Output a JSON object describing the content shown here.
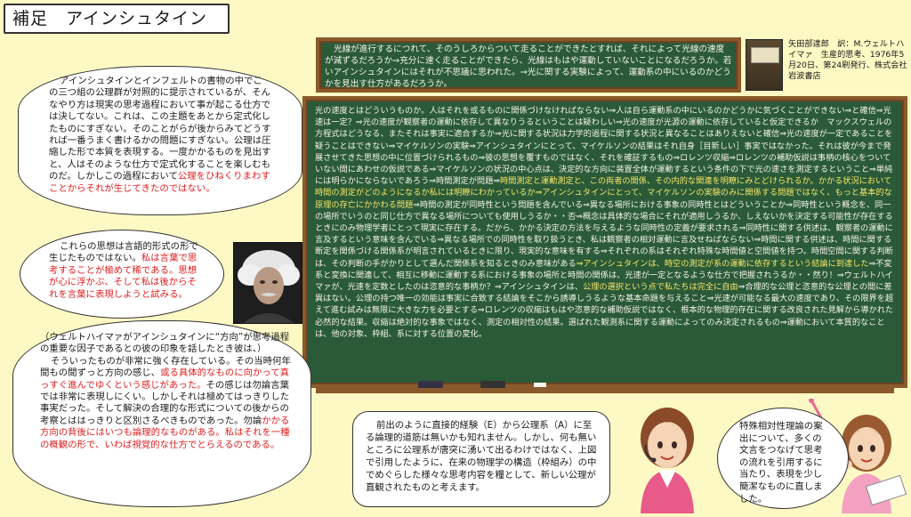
{
  "title": "補足　アインシュタイン",
  "book": {
    "info": "矢田部達郎　訳：M.ウェルトハイマァ　生産的思考、1976年5月20日、第24刷発行、株式会社　岩波書店"
  },
  "top_board": {
    "text": "光線が進行するにつれて、そのうしろからついて走ることができたとすれば、それによって光線の速度が減ずるだろうか⇒充分に速く走ることができたら、光線はもはや運動していないことになるだろうか。若いアインシュタインにはそれが不思議に思われた。⇒光に関する実験によって、運動系の中にいるのかどうかを見出す仕方があるだろうか。"
  },
  "main_board": {
    "t1": "光の速度とはどういうものか。人はそれを或るものに関係づけなければならない⇒人は自ら運動系の中にいるのかどうかに気づくことができない⇒と確信⇒光速は一定？⇒光の速度が観察者の運動に依存して異なりうるということは疑わしい⇒光の速度が光源の運動に依存していると仮定できるか　マックスウェルの方程式はどうなる、またそれは事実に適合するか⇒光に関する状況は力学的過程に関する状況と異なることはありえないと確信⇒光の速度が一定であることを疑うことはできない⇒マイケルソンの実験⇒アインシュタインにとって、マイケルソンの結果はそれ自身［目新しい］事実ではなかった。それは彼が今まで発展させてきた思想の中に位置づけられるもの⇒彼の思想を覆すものではなく、それを確証するもの⇒ロレンツ収縮⇒ロレンツの補助仮説は事柄の核心をついていない間にあわせの仮説である⇒マイケルソンの状況の中心点は、決定的な方向に装置全体が運動するという条件の下で光の速さを測定するということ⇒単純には明らかにならないであろう⇒時間測定が問題⇒",
    "t2": "時間測定と運動測定と、この両者の関係、その内的な関連を明瞭にみとどけられるか。かかる状況において時間の測定がどのようになるか私には明瞭にわかっているか⇒アインシュタインにとって、マイケルソンの実験のみに関係する問題ではなく、もっと基本的な原理の存亡にかかわる問題",
    "t3": "⇒時間の測定が同時性という問題を含んでいる⇒異なる場所における事象の同時性とはどういうことか⇒同時性という概念を、同一の場所でいうのと同じ仕方で異なる場所についても使用しうるか・・否⇒概念は具体的な場合にそれが適用しうるか、しえないかを決定する可能性が存在するときにのみ物理学者にとって現実に存在する。だから、かかる決定の方法を与えるような同時性の定義が要求される⇒同時性に関する供述は、観察者の運動に言及するという意味を含んでいる⇒異なる場所での同時性を取り扱うとき、私は観察者の相対運動に言及せねばならない⇒時間に関する供述は、時間に関する断定を関係づける関係系が明言されているときに限り、現実的な意味を有する⇒それぞれの系はそれぞれ特殊な時間値と空間値を持つ。時間空間に関する判断は、その判断の手がかりとして選んだ関係系を知るときのみ意味がある",
    "t4": "⇒アインシュタインは、時空の測定が系の運動に依存するという結論に到達した",
    "t5": "⇒不変系と変換に関連して、相互に移動に運動する系における事象の場所と時間の関係は、光速が一定となるような仕方で把握されうるか・・然り！⇒ウェルトハイマァが、光速を定数としたのは恣意的な事柄か？⇒アインシュタインは、",
    "t6": "公理の選択という点で私たちは完全に自由",
    "t7": "⇒合理的な公理と恣意的な公理との間に差異はない。公理の持つ唯一の効能は事実に合致する結論をそこから誘導しうるような基本命題を与えること⇒光速が可能なる最大の速度であり、その限界を超えて進む試みは無限に大きな力を必要とする⇒ロレンツの収縮はもはや恣意的な補助仮説ではなく、根本的な物理的存在に関する改良された見解から導かれた必然的な結果。収縮は絶対的な事象ではなく、測定の相対性の結果。選ばれた観測系に関する運動によってのみ決定されるもの⇒運動において本質的なことは、他の対象、枠組、系に対する位置の変化。"
  },
  "bubble_1": {
    "text": "アインシュタインとインフェルトの書物の中でこの三つ組の公理群が対照的に提示されているが、そんなやり方は現実の思考過程において事が起こる仕方では決してない。これは、この主題をあとから定式化したものにすぎない。そのことがらが後からみてどうすれば一番うまく書けるかの問題にすぎない。公理は圧縮した形で本質を表現する。一度かかるものを見出すと、人はそのような仕方で定式化することを楽しむものだ。しかしこの過程において",
    "red": "公理をひねくりまわすことからそれが生じてきたのではない。"
  },
  "bubble_2": {
    "text": "これらの思想は言語的形式の形で生じたものではない。",
    "red": "私は言葉で思考することが極めて稀である。思想が心に浮かぶ、そして私は後からそれを言葉に表現しようと試みる。"
  },
  "bubble_3": {
    "intro": "（ウェルトハイマァがアインシュタインに“方向”が思考過程の重要な因子であるとの彼の印象を話したとき彼は、）",
    "t1": "そういったものが非常に強く存在している。その当時何年間もの間ずっと方向の感じ、",
    "r1": "或る具体的なものに向かって真っすぐ進んでゆくという感じがあった。",
    "t2": "その感じは勿論言葉では非常に表現しにくい。しかしそれは極めてはっきりした事実だった。そして解決の合理的な形式についての後からの考察とははっきりと区別さるべきものであった。勿論",
    "r2": "かかる方向の背後にはいつも論理的なものがある。私はそれを一種の概観の形で、いわば視覚的な仕方でとらえるのである。"
  },
  "bubble_4": {
    "text": "前出のように直接的経験（E）から公理系（A）に至る論理的道筋は無いかも知れません。しかし、何も無いところに公理系が唐突に湧いて出るわけではなく、上図で引用したように、在来の物理学の構造（枠組み）の中でめぐらした様々な思考内容を糧として、新しい公理が直観されたものと考えます。"
  },
  "bubble_5": {
    "text": "特殊相対性理論の案出について、多くの文言をつなげて思考の流れを引用するに当たり、表現を少し簡潔なものに直しました。"
  }
}
